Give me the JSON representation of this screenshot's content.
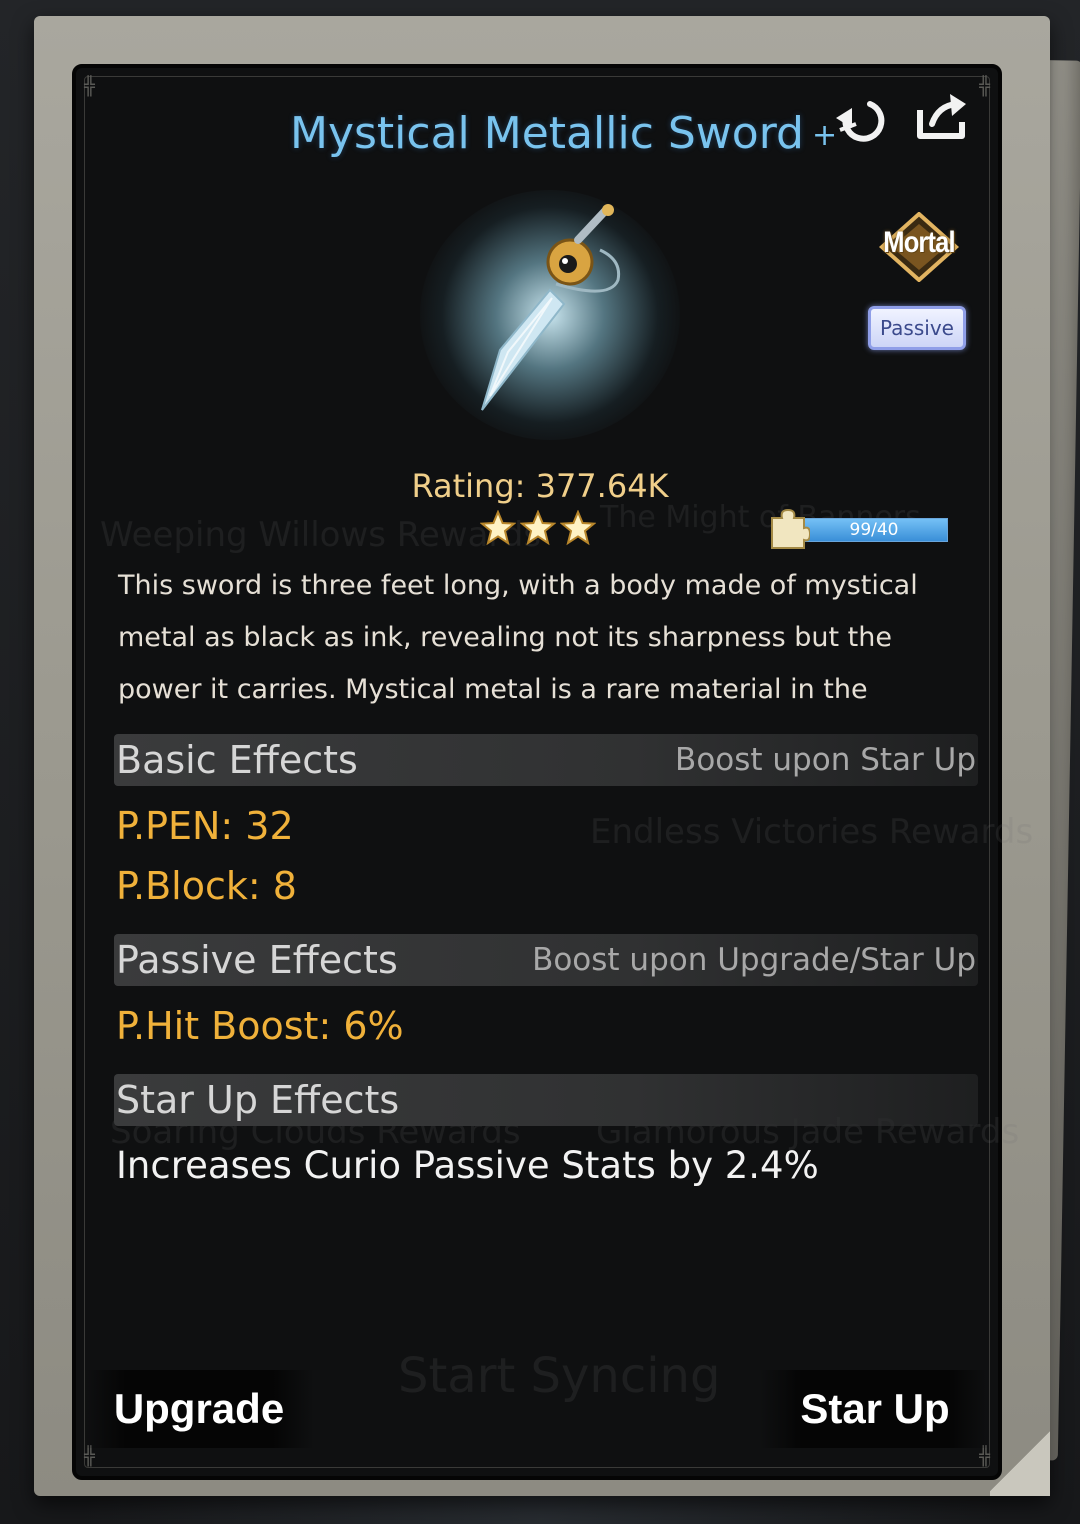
{
  "item": {
    "name": "Mystical Metallic Sword",
    "plus_mark": "+",
    "rank": "Mortal",
    "type": "Passive",
    "rating": "Rating: 377.64K",
    "stars": 3,
    "shards": {
      "text": "99/40",
      "fill_fraction": 1.0
    },
    "description": "This sword is three feet long, with a body made of mystical metal as black as ink, revealing not its sharpness but the power it carries. Mystical metal is a rare material in the"
  },
  "sections": {
    "basic": {
      "title": "Basic Effects",
      "note": "Boost upon Star Up",
      "stats": [
        "P.PEN: 32",
        "P.Block: 8"
      ]
    },
    "passive": {
      "title": "Passive Effects",
      "note": "Boost upon Upgrade/Star Up",
      "stats": [
        "P.Hit Boost: 6%"
      ]
    },
    "star_up": {
      "title": "Star Up Effects",
      "text": "Increases Curio Passive Stats by 2.4%"
    }
  },
  "buttons": {
    "upgrade": "Upgrade",
    "star_up": "Star Up"
  },
  "icons": {
    "top_right": [
      "swap-icon",
      "share-icon"
    ],
    "progress": "puzzle-piece-icon"
  },
  "colors": {
    "title": "#79c3ee",
    "stat": "#f0b13a",
    "rating": "#f0cf8a",
    "progress": "#3a8fd8"
  },
  "background_ghost_text": {
    "line1": "Weeping Willows  Rewards",
    "line2": "The Might of Banners",
    "line3": "Endless Victories  Rewards",
    "line4": "Soaring Clouds  Rewards",
    "line5": "Glamorous Jade  Rewards",
    "line6": "Start Syncing"
  }
}
